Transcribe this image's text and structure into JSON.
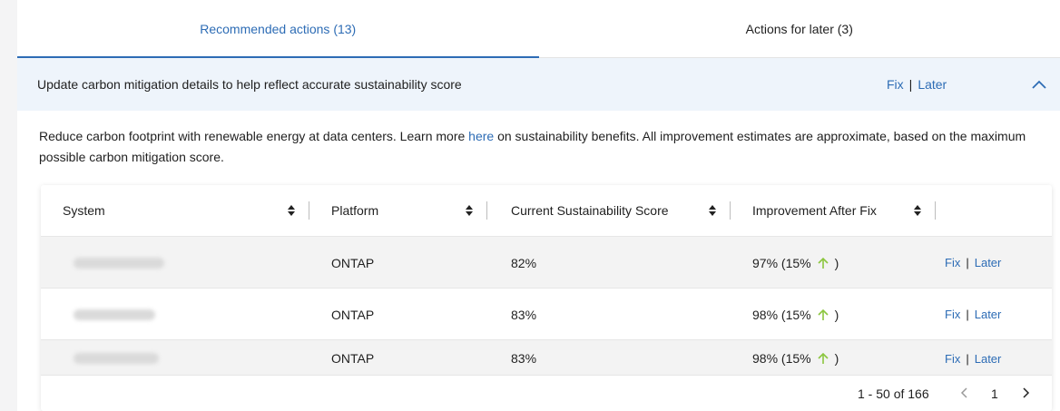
{
  "tabs": [
    {
      "label": "Recommended actions (13)",
      "active": true
    },
    {
      "label": "Actions for later (3)",
      "active": false
    }
  ],
  "accordion": {
    "title": "Update carbon mitigation details to help reflect accurate sustainability score",
    "fix_label": "Fix",
    "separator": "|",
    "later_label": "Later"
  },
  "description": {
    "before_link": "Reduce carbon footprint with renewable energy at data centers. Learn more ",
    "link_text": "here",
    "after_link": " on sustainability benefits. All improvement estimates are approximate, based on the maximum possible carbon mitigation score."
  },
  "table": {
    "columns": [
      "System",
      "Platform",
      "Current Sustainability Score",
      "Improvement After Fix"
    ],
    "rows": [
      {
        "platform": "ONTAP",
        "score": "82%",
        "improvement": "97% (15%",
        "close": ")",
        "fix": "Fix",
        "later": "Later"
      },
      {
        "platform": "ONTAP",
        "score": "83%",
        "improvement": "98% (15%",
        "close": ")",
        "fix": "Fix",
        "later": "Later"
      },
      {
        "platform": "ONTAP",
        "score": "83%",
        "improvement": "98% (15%",
        "close": ")",
        "fix": "Fix",
        "later": "Later"
      }
    ],
    "separator": "|"
  },
  "pagination": {
    "range": "1 - 50 of 166",
    "page": "1"
  },
  "colors": {
    "accent": "#2d6cb5",
    "header_bg": "#eef4fb",
    "arrow_up": "#8cc63f"
  }
}
